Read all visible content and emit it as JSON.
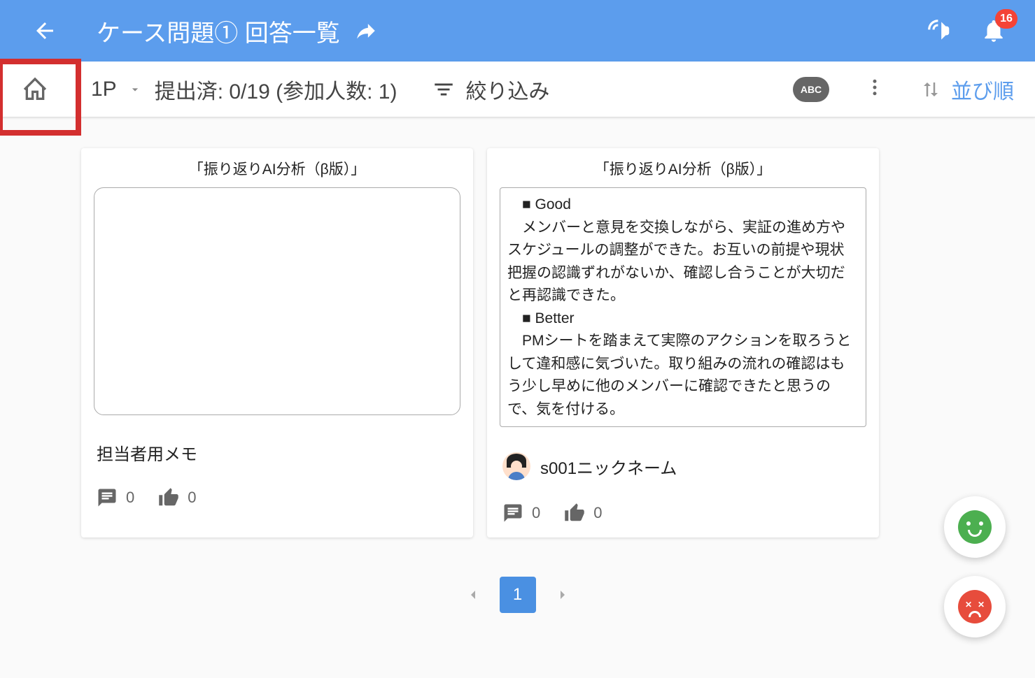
{
  "header": {
    "title": "ケース問題① 回答一覧",
    "notification_count": "16"
  },
  "toolbar": {
    "page_label": "1P",
    "submission_status": "提出済: 0/19 (参加人数: 1)",
    "filter_label": "絞り込み",
    "abc_label": "ABC",
    "sort_label": "並び順"
  },
  "cards": [
    {
      "heading": "「振り返りAI分析（β版）」",
      "content": "",
      "author": "担当者用メモ",
      "has_avatar": false,
      "comment_count": "0",
      "like_count": "0"
    },
    {
      "heading": "「振り返りAI分析（β版）」",
      "content": "　■ Good\n　メンバーと意見を交換しながら、実証の進め方やスケジュールの調整ができた。お互いの前提や現状把握の認識ずれがないか、確認し合うことが大切だと再認識できた。\n　■ Better\n　PMシートを踏まえて実際のアクションを取ろうとして違和感に気づいた。取り組みの流れの確認はもう少し早めに他のメンバーに確認できたと思うので、気を付ける。",
      "author": "s001ニックネーム",
      "has_avatar": true,
      "comment_count": "0",
      "like_count": "0"
    }
  ],
  "pagination": {
    "current": "1"
  }
}
